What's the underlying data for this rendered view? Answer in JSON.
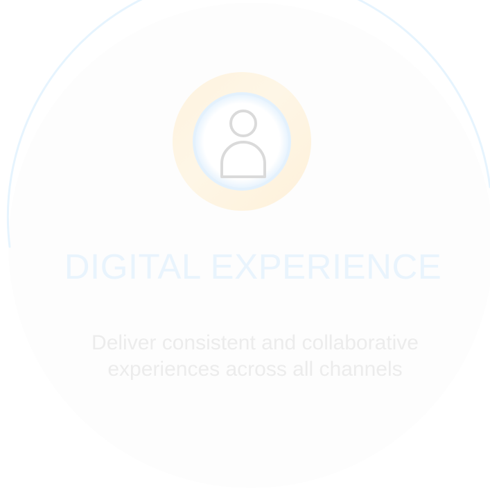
{
  "card": {
    "icon": "user-icon",
    "title": "DIGITAL EXPERIENCE",
    "description": "Deliver consistent and collaborative experiences across all channels"
  },
  "colors": {
    "arc": "#e6f4fe",
    "title": "#e9f4fd",
    "description": "#ececec",
    "ring_blue": "#e3f1fd",
    "ring_yellow": "#fef3df",
    "icon_stroke": "#dadada"
  }
}
